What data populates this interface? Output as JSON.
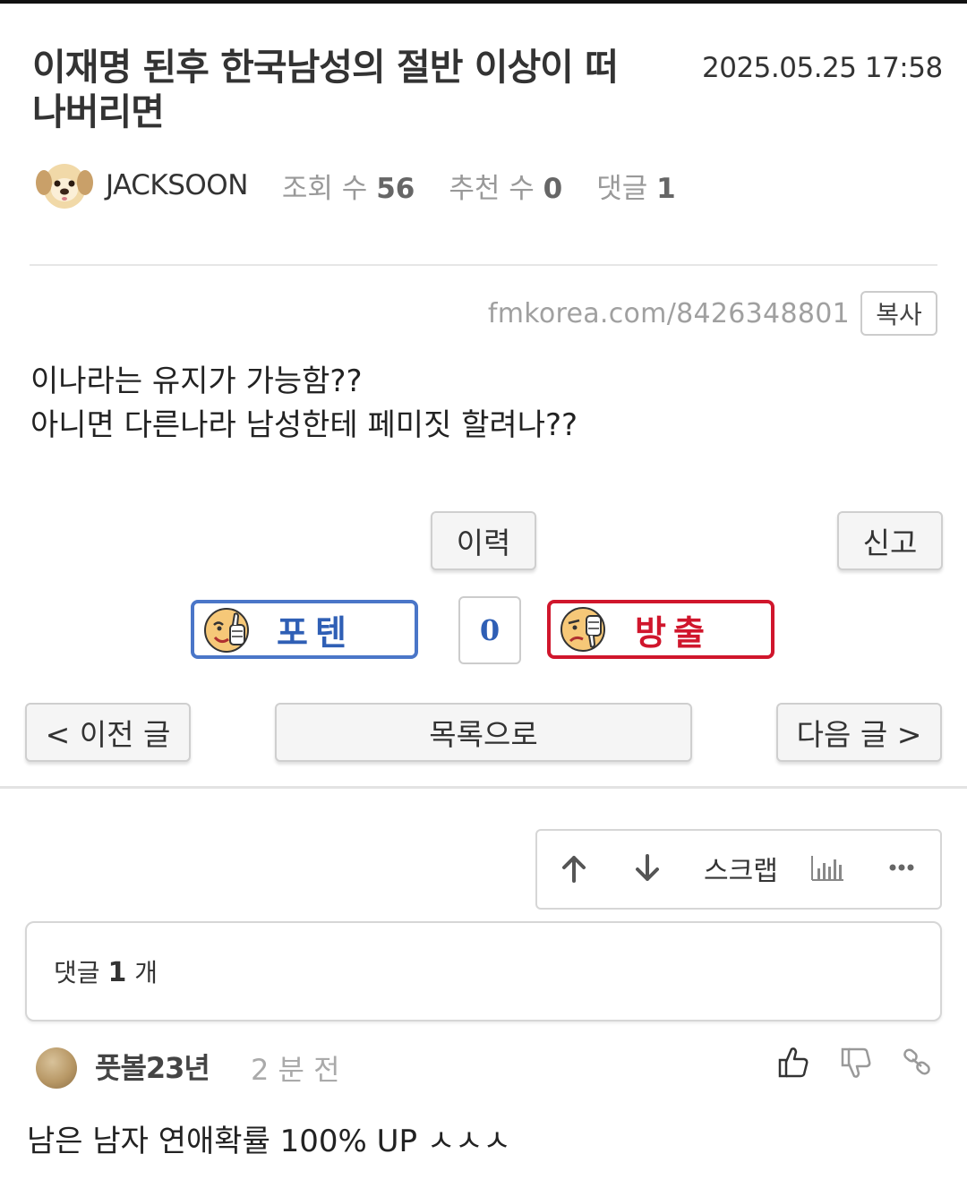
{
  "post": {
    "title_line1": "이재명 된후 한국남성의 절반 이상이 떠",
    "title_line2": "나버리면",
    "date": "2025.05.25 17:58",
    "author": "JACKSOON",
    "views_label": "조회 수",
    "views": "56",
    "recommend_label": "추천 수",
    "recommend": "0",
    "comments_label": "댓글",
    "comments": "1",
    "url": "fmkorea.com/8426348801",
    "copy_label": "복사",
    "body_line1": "이나라는 유지가 가능함??",
    "body_line2": "아니면 다른나라 남성한테 페미짓 할려나??"
  },
  "actions": {
    "history_label": "이력",
    "report_label": "신고",
    "vote_up_label": "포텐",
    "vote_down_label": "방출",
    "vote_count": "0",
    "prev_label": "< 이전 글",
    "list_label": "목록으로",
    "next_label": "다음 글 >"
  },
  "toolbar": {
    "scrap_label": "스크랩",
    "icons": [
      "arrow-up-icon",
      "arrow-down-icon",
      "bar-chart-icon",
      "more-icon"
    ]
  },
  "comment_section": {
    "label_prefix": "댓글",
    "count": "1",
    "label_suffix": "개"
  },
  "comments": [
    {
      "author": "풋볼23년",
      "time": "2 분 전",
      "text": "남은 남자 연애확률 100% UP ㅅㅅㅅ"
    }
  ],
  "colors": {
    "vote_up": "#4a76c8",
    "vote_down": "#d0162c",
    "muted_text": "#999999"
  }
}
